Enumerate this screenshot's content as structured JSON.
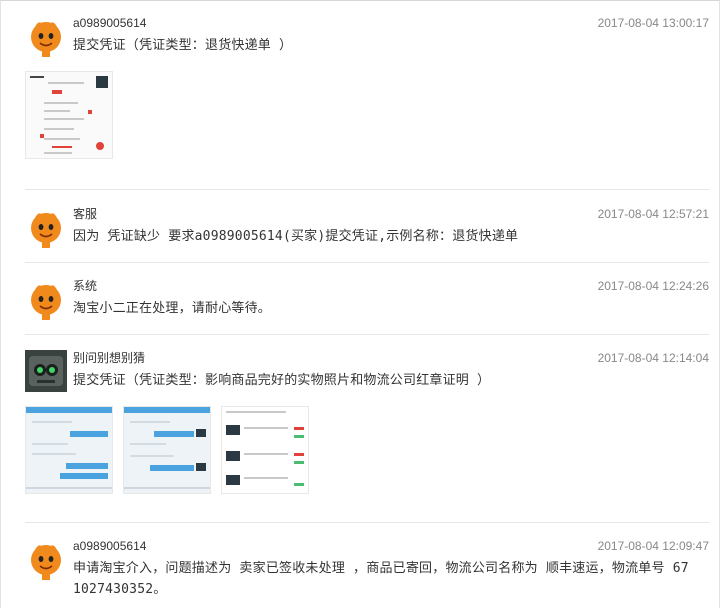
{
  "entries": [
    {
      "name": "a0989005614",
      "time": "2017-08-04 13:00:17",
      "message": "提交凭证（凭证类型：退货快递单 ）",
      "avatar": "orange-mascot",
      "thumbnails": [
        "receipt-screenshot"
      ]
    },
    {
      "name": "客服",
      "time": "2017-08-04 12:57:21",
      "message": "因为 凭证缺少 要求a0989005614(买家)提交凭证,示例名称：退货快递单",
      "avatar": "orange-mascot"
    },
    {
      "name": "系统",
      "time": "2017-08-04 12:24:26",
      "message": "淘宝小二正在处理，请耐心等待。",
      "avatar": "orange-mascot"
    },
    {
      "name": "别问别想别猜",
      "time": "2017-08-04 12:14:04",
      "message": "提交凭证（凭证类型：影响商品完好的实物照片和物流公司红章证明 ）",
      "avatar": "robot-photo",
      "thumbnails": [
        "chat-screenshot-1",
        "chat-screenshot-2",
        "order-list-screenshot"
      ]
    },
    {
      "name": "a0989005614",
      "time": "2017-08-04 12:09:47",
      "message_line1": "申请淘宝介入，问题描述为 卖家已签收未处理 ，商品已寄回，物流公司名称为 顺丰速运，物流单号 67",
      "message_line2": "1027430352。",
      "avatar": "orange-mascot"
    }
  ],
  "colors": {
    "mascot_orange": "#f08a1c",
    "divider": "#e6e6e6",
    "time_text": "#888888"
  }
}
